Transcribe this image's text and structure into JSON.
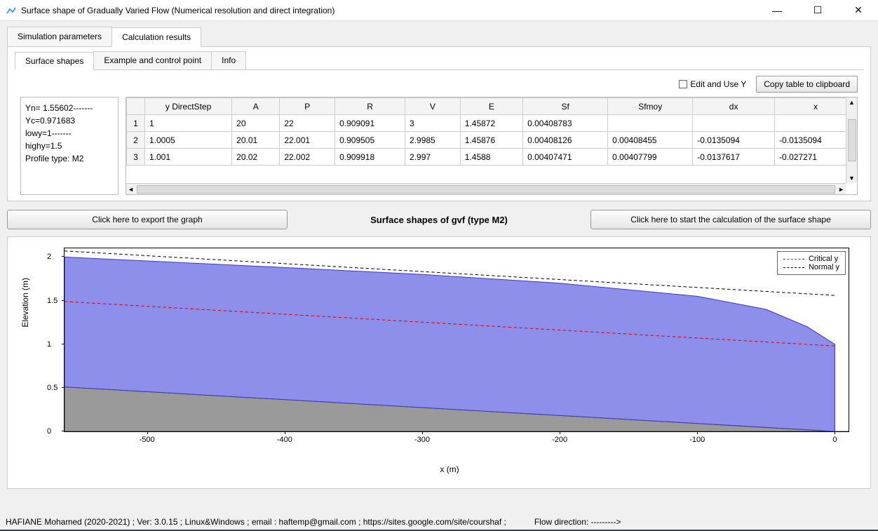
{
  "window": {
    "title": "Surface shape of Gradually Varied Flow (Numerical resolution and direct integration)"
  },
  "mainTabs": [
    "Simulation parameters",
    "Calculation results"
  ],
  "mainTabActive": 1,
  "subTabs": [
    "Surface shapes",
    "Example and control point",
    "Info"
  ],
  "subTabActive": 0,
  "editUseY": {
    "label": "Edit and Use Y",
    "checked": false
  },
  "copyBtn": "Copy table to clipboard",
  "info": {
    "lines": [
      "Yn= 1.55602-------",
      "Yc=0.971683",
      "lowy=1-------",
      "highy=1.5",
      "Profile type: M2"
    ]
  },
  "table": {
    "headers": [
      "",
      "y DirectStep",
      "A",
      "P",
      "R",
      "V",
      "E",
      "Sf",
      "Sfmoy",
      "dx",
      "x"
    ],
    "rows": [
      [
        "1",
        "1",
        "20",
        "22",
        "0.909091",
        "3",
        "1.45872",
        "0.00408783",
        "",
        "",
        ""
      ],
      [
        "2",
        "1.0005",
        "20.01",
        "22.001",
        "0.909505",
        "2.9985",
        "1.45876",
        "0.00408126",
        "0.00408455",
        "-0.0135094",
        "-0.0135094"
      ],
      [
        "3",
        "1.001",
        "20.02",
        "22.002",
        "0.909918",
        "2.997",
        "1.4588",
        "0.00407471",
        "0.00407799",
        "-0.0137617",
        "-0.027271"
      ]
    ]
  },
  "exportBtn": "Click here to export the graph",
  "chartTitle": "Surface shapes of gvf (type M2)",
  "calcBtn": "Click here to start the calculation of the surface shape",
  "chart_data": {
    "type": "area",
    "title": "Surface shapes of gvf (type M2)",
    "xlabel": "x (m)",
    "ylabel": "Elevation (m)",
    "xlim": [
      -560,
      10
    ],
    "ylim": [
      0,
      2.1
    ],
    "xticks": [
      -500,
      -400,
      -300,
      -200,
      -100,
      0
    ],
    "yticks": [
      0,
      0.5,
      1,
      1.5,
      2
    ],
    "series": [
      {
        "name": "Normal y",
        "style": "dashed-black",
        "points": [
          [
            -560,
            2.07
          ],
          [
            0,
            1.56
          ]
        ]
      },
      {
        "name": "Critical y",
        "style": "dashed-red",
        "points": [
          [
            -560,
            1.49
          ],
          [
            0,
            0.98
          ]
        ]
      },
      {
        "name": "Water surface",
        "style": "fill-blue",
        "points": [
          [
            -560,
            2.0
          ],
          [
            -400,
            1.88
          ],
          [
            -300,
            1.8
          ],
          [
            -200,
            1.7
          ],
          [
            -100,
            1.55
          ],
          [
            -50,
            1.4
          ],
          [
            -20,
            1.2
          ],
          [
            0,
            1.0
          ]
        ]
      },
      {
        "name": "Bed",
        "style": "fill-grey",
        "points": [
          [
            -560,
            0.51
          ],
          [
            0,
            0.0
          ]
        ]
      }
    ],
    "legend": [
      "Critical y",
      "Normal y"
    ]
  },
  "status": {
    "left": "HAFIANE Mohamed (2020-2021) ; Ver: 3.0.15 ; Linux&Windows ; email : haftemp@gmail.com ; https://sites.google.com/site/courshaf     ;",
    "right": "Flow direction: --------->"
  }
}
